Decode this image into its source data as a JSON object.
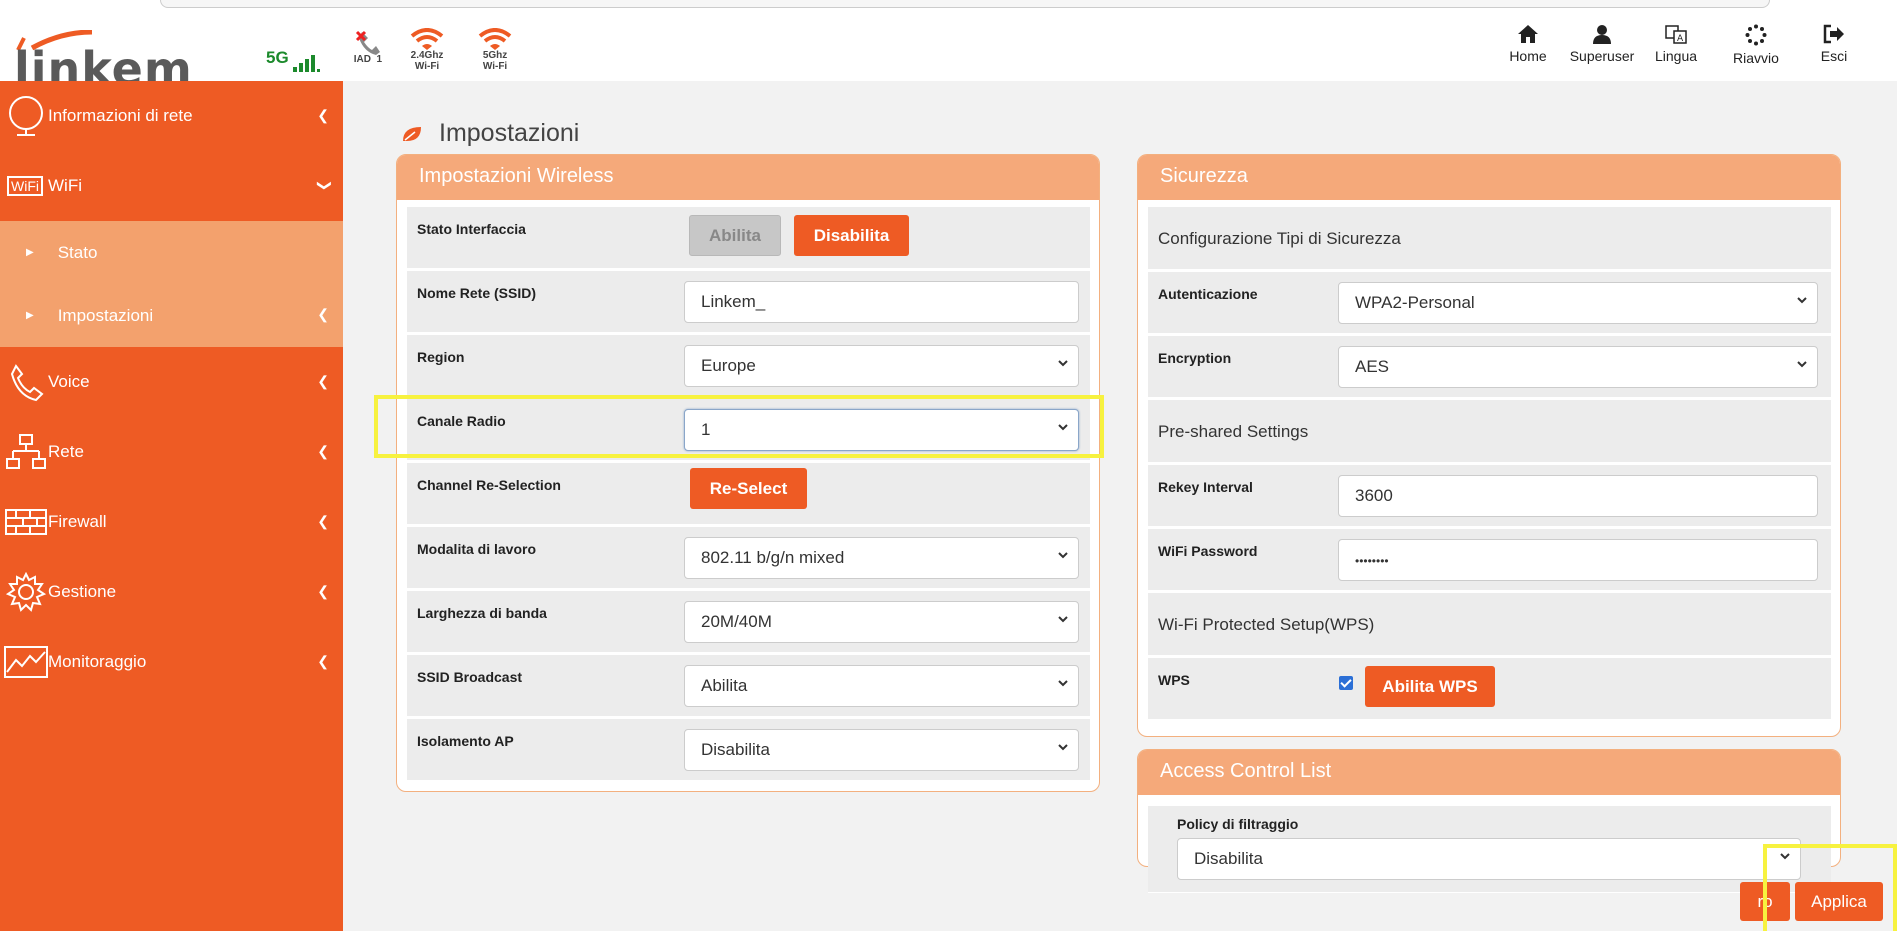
{
  "header": {
    "logo_text": "linkem",
    "status": {
      "network": "5G",
      "iad_label": "IAD",
      "iad_count": "1",
      "wifi24_label_1": "2.4Ghz",
      "wifi24_label_2": "Wi-Fi",
      "wifi5_label_1": "5Ghz",
      "wifi5_label_2": "Wi-Fi"
    },
    "nav": [
      {
        "label": "Home",
        "icon": "home-icon"
      },
      {
        "label": "Superuser",
        "icon": "user-icon"
      },
      {
        "label": "Lingua",
        "icon": "language-icon"
      },
      {
        "label": "Riavvio",
        "icon": "reboot-icon"
      },
      {
        "label": "Esci",
        "icon": "logout-icon"
      }
    ]
  },
  "sidebar": {
    "items": [
      {
        "label": "Informazioni di rete",
        "icon": "globe-icon"
      },
      {
        "label": "WiFi",
        "icon": "wifi-badge-icon",
        "badge": "WiFi"
      },
      {
        "label": "Voice",
        "icon": "phone-icon"
      },
      {
        "label": "Rete",
        "icon": "network-icon"
      },
      {
        "label": "Firewall",
        "icon": "firewall-icon"
      },
      {
        "label": "Gestione",
        "icon": "gear-icon"
      },
      {
        "label": "Monitoraggio",
        "icon": "chart-icon"
      }
    ],
    "wifi_sub": [
      {
        "label": "Stato"
      },
      {
        "label": "Impostazioni"
      }
    ]
  },
  "main": {
    "title": "Impostazioni",
    "wireless": {
      "title": "Impostazioni Wireless",
      "interface_label": "Stato Interfaccia",
      "enable_label": "Abilita",
      "disable_label": "Disabilita",
      "ssid_label": "Nome Rete (SSID)",
      "ssid_value": "Linkem_",
      "region_label": "Region",
      "region_value": "Europe",
      "channel_label": "Canale Radio",
      "channel_value": "1",
      "reselect_label": "Channel Re-Selection",
      "reselect_button": "Re-Select",
      "mode_label": "Modalita di lavoro",
      "mode_value": "802.11 b/g/n mixed",
      "bandwidth_label": "Larghezza di banda",
      "bandwidth_value": "20M/40M",
      "broadcast_label": "SSID Broadcast",
      "broadcast_value": "Abilita",
      "isolation_label": "Isolamento AP",
      "isolation_value": "Disabilita"
    },
    "security": {
      "title": "Sicurezza",
      "types_section": "Configurazione Tipi di Sicurezza",
      "auth_label": "Autenticazione",
      "auth_value": "WPA2-Personal",
      "enc_label": "Encryption",
      "enc_value": "AES",
      "psk_section": "Pre-shared Settings",
      "rekey_label": "Rekey Interval",
      "rekey_value": "3600",
      "password_label": "WiFi Password",
      "password_value": "••••••••",
      "wps_section": "Wi-Fi Protected Setup(WPS)",
      "wps_label": "WPS",
      "wps_checked": true,
      "wps_button": "Abilita WPS"
    },
    "acl": {
      "title": "Access Control List",
      "policy_label": "Policy di filtraggio",
      "policy_value": "Disabilita"
    },
    "footer": {
      "back_label": "ro",
      "apply_label": "Applica"
    }
  },
  "colors": {
    "brand_orange": "#ee5b24",
    "panel_header": "#f5a97a",
    "submenu_bg": "#f3a16d",
    "highlight": "#f7f23f"
  }
}
